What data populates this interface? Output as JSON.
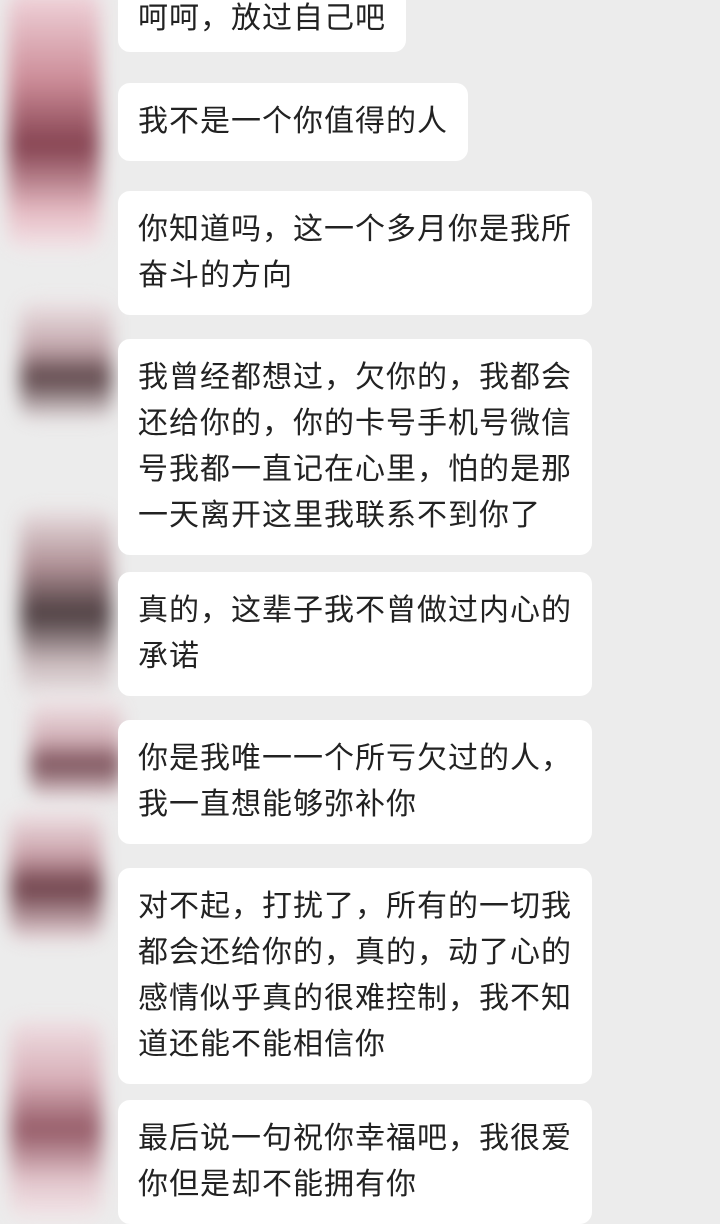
{
  "messages": [
    {
      "text": "呵呵，放过自己吧"
    },
    {
      "text": "我不是一个你值得的人"
    },
    {
      "text": "你知道吗，这一个多月你是我所\n奋斗的方向"
    },
    {
      "text": "我曾经都想过，欠你的，我都会\n还给你的，你的卡号手机号微信\n号我都一直记在心里，怕的是那\n一天离开这里我联系不到你了"
    },
    {
      "text": "真的，这辈子我不曾做过内心的\n承诺"
    },
    {
      "text": "你是我唯一一个所亏欠过的人，\n我一直想能够弥补你"
    },
    {
      "text": "对不起，打扰了，所有的一切我\n都会还给你的，真的，动了心的\n感情似乎真的很难控制，我不知\n道还能不能相信你"
    },
    {
      "text": "最后说一句祝你幸福吧，我很爱\n你但是却不能拥有你"
    }
  ]
}
